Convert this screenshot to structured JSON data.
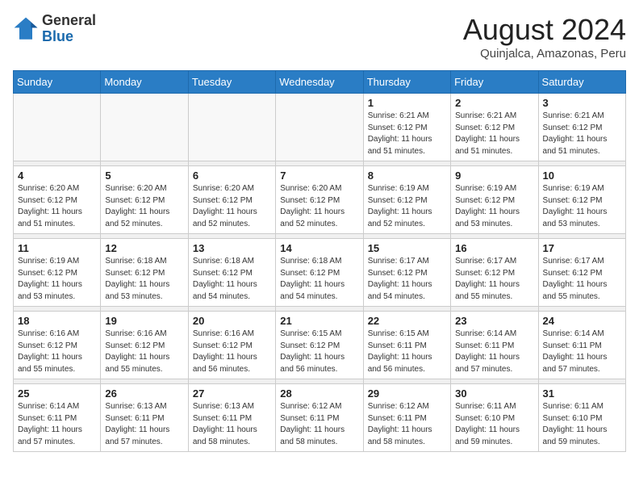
{
  "logo": {
    "general": "General",
    "blue": "Blue"
  },
  "title": "August 2024",
  "location": "Quinjalca, Amazonas, Peru",
  "days_of_week": [
    "Sunday",
    "Monday",
    "Tuesday",
    "Wednesday",
    "Thursday",
    "Friday",
    "Saturday"
  ],
  "weeks": [
    [
      {
        "day": "",
        "info": ""
      },
      {
        "day": "",
        "info": ""
      },
      {
        "day": "",
        "info": ""
      },
      {
        "day": "",
        "info": ""
      },
      {
        "day": "1",
        "info": "Sunrise: 6:21 AM\nSunset: 6:12 PM\nDaylight: 11 hours\nand 51 minutes."
      },
      {
        "day": "2",
        "info": "Sunrise: 6:21 AM\nSunset: 6:12 PM\nDaylight: 11 hours\nand 51 minutes."
      },
      {
        "day": "3",
        "info": "Sunrise: 6:21 AM\nSunset: 6:12 PM\nDaylight: 11 hours\nand 51 minutes."
      }
    ],
    [
      {
        "day": "4",
        "info": "Sunrise: 6:20 AM\nSunset: 6:12 PM\nDaylight: 11 hours\nand 51 minutes."
      },
      {
        "day": "5",
        "info": "Sunrise: 6:20 AM\nSunset: 6:12 PM\nDaylight: 11 hours\nand 52 minutes."
      },
      {
        "day": "6",
        "info": "Sunrise: 6:20 AM\nSunset: 6:12 PM\nDaylight: 11 hours\nand 52 minutes."
      },
      {
        "day": "7",
        "info": "Sunrise: 6:20 AM\nSunset: 6:12 PM\nDaylight: 11 hours\nand 52 minutes."
      },
      {
        "day": "8",
        "info": "Sunrise: 6:19 AM\nSunset: 6:12 PM\nDaylight: 11 hours\nand 52 minutes."
      },
      {
        "day": "9",
        "info": "Sunrise: 6:19 AM\nSunset: 6:12 PM\nDaylight: 11 hours\nand 53 minutes."
      },
      {
        "day": "10",
        "info": "Sunrise: 6:19 AM\nSunset: 6:12 PM\nDaylight: 11 hours\nand 53 minutes."
      }
    ],
    [
      {
        "day": "11",
        "info": "Sunrise: 6:19 AM\nSunset: 6:12 PM\nDaylight: 11 hours\nand 53 minutes."
      },
      {
        "day": "12",
        "info": "Sunrise: 6:18 AM\nSunset: 6:12 PM\nDaylight: 11 hours\nand 53 minutes."
      },
      {
        "day": "13",
        "info": "Sunrise: 6:18 AM\nSunset: 6:12 PM\nDaylight: 11 hours\nand 54 minutes."
      },
      {
        "day": "14",
        "info": "Sunrise: 6:18 AM\nSunset: 6:12 PM\nDaylight: 11 hours\nand 54 minutes."
      },
      {
        "day": "15",
        "info": "Sunrise: 6:17 AM\nSunset: 6:12 PM\nDaylight: 11 hours\nand 54 minutes."
      },
      {
        "day": "16",
        "info": "Sunrise: 6:17 AM\nSunset: 6:12 PM\nDaylight: 11 hours\nand 55 minutes."
      },
      {
        "day": "17",
        "info": "Sunrise: 6:17 AM\nSunset: 6:12 PM\nDaylight: 11 hours\nand 55 minutes."
      }
    ],
    [
      {
        "day": "18",
        "info": "Sunrise: 6:16 AM\nSunset: 6:12 PM\nDaylight: 11 hours\nand 55 minutes."
      },
      {
        "day": "19",
        "info": "Sunrise: 6:16 AM\nSunset: 6:12 PM\nDaylight: 11 hours\nand 55 minutes."
      },
      {
        "day": "20",
        "info": "Sunrise: 6:16 AM\nSunset: 6:12 PM\nDaylight: 11 hours\nand 56 minutes."
      },
      {
        "day": "21",
        "info": "Sunrise: 6:15 AM\nSunset: 6:12 PM\nDaylight: 11 hours\nand 56 minutes."
      },
      {
        "day": "22",
        "info": "Sunrise: 6:15 AM\nSunset: 6:11 PM\nDaylight: 11 hours\nand 56 minutes."
      },
      {
        "day": "23",
        "info": "Sunrise: 6:14 AM\nSunset: 6:11 PM\nDaylight: 11 hours\nand 57 minutes."
      },
      {
        "day": "24",
        "info": "Sunrise: 6:14 AM\nSunset: 6:11 PM\nDaylight: 11 hours\nand 57 minutes."
      }
    ],
    [
      {
        "day": "25",
        "info": "Sunrise: 6:14 AM\nSunset: 6:11 PM\nDaylight: 11 hours\nand 57 minutes."
      },
      {
        "day": "26",
        "info": "Sunrise: 6:13 AM\nSunset: 6:11 PM\nDaylight: 11 hours\nand 57 minutes."
      },
      {
        "day": "27",
        "info": "Sunrise: 6:13 AM\nSunset: 6:11 PM\nDaylight: 11 hours\nand 58 minutes."
      },
      {
        "day": "28",
        "info": "Sunrise: 6:12 AM\nSunset: 6:11 PM\nDaylight: 11 hours\nand 58 minutes."
      },
      {
        "day": "29",
        "info": "Sunrise: 6:12 AM\nSunset: 6:11 PM\nDaylight: 11 hours\nand 58 minutes."
      },
      {
        "day": "30",
        "info": "Sunrise: 6:11 AM\nSunset: 6:10 PM\nDaylight: 11 hours\nand 59 minutes."
      },
      {
        "day": "31",
        "info": "Sunrise: 6:11 AM\nSunset: 6:10 PM\nDaylight: 11 hours\nand 59 minutes."
      }
    ]
  ]
}
